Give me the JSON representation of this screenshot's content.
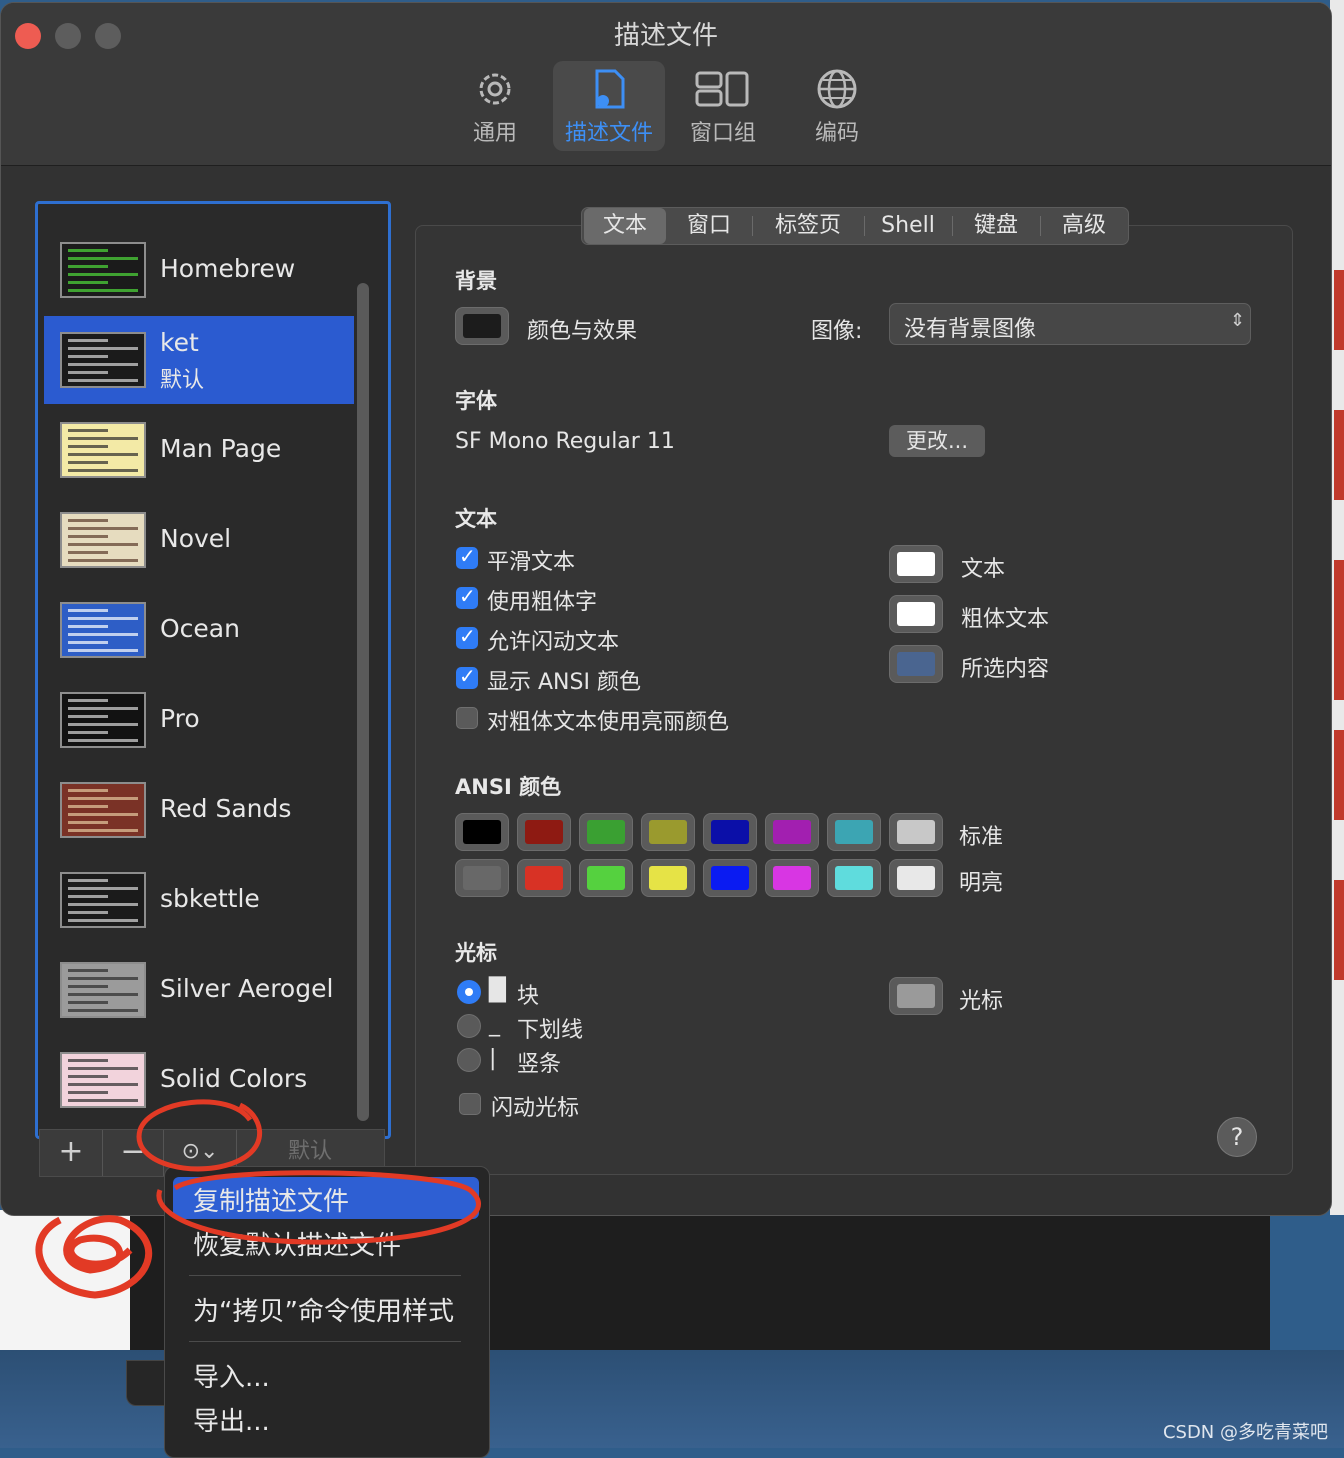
{
  "window": {
    "title": "描述文件"
  },
  "toolbar": {
    "items": [
      {
        "label": "通用",
        "icon": "gear-icon"
      },
      {
        "label": "描述文件",
        "icon": "profile-doc-icon"
      },
      {
        "label": "窗口组",
        "icon": "window-groups-icon"
      },
      {
        "label": "编码",
        "icon": "globe-icon"
      }
    ],
    "active": "描述文件"
  },
  "profiles": {
    "items": [
      {
        "name": "Homebrew",
        "thumb_bg": "#1b1b1b",
        "thumb_fg": "#4fdb3a"
      },
      {
        "name": "ket",
        "subtitle": "默认",
        "thumb_bg": "#1b1b1b",
        "thumb_fg": "#d8d8d8"
      },
      {
        "name": "Man Page",
        "thumb_bg": "#f3eaa6",
        "thumb_fg": "#2b2b2b"
      },
      {
        "name": "Novel",
        "thumb_bg": "#e6dcbf",
        "thumb_fg": "#5a3b2b"
      },
      {
        "name": "Ocean",
        "thumb_bg": "#2e5ec6",
        "thumb_fg": "#ffffff"
      },
      {
        "name": "Pro",
        "thumb_bg": "#121212",
        "thumb_fg": "#d8d8d8"
      },
      {
        "name": "Red Sands",
        "thumb_bg": "#7a3226",
        "thumb_fg": "#e6c9a0"
      },
      {
        "name": "sbkettle",
        "thumb_bg": "#1b1b1b",
        "thumb_fg": "#d8d8d8"
      },
      {
        "name": "Silver Aerogel",
        "thumb_bg": "#9b9b9b",
        "thumb_fg": "#2b2b2b"
      },
      {
        "name": "Solid Colors",
        "thumb_bg": "#f2d3dc",
        "thumb_fg": "#2b2b2b"
      }
    ],
    "selected": "ket",
    "buttons": {
      "add": "+",
      "remove": "−",
      "default": "默认"
    }
  },
  "tabs": {
    "items": [
      "文本",
      "窗口",
      "标签页",
      "Shell",
      "键盘",
      "高级"
    ],
    "active": "文本"
  },
  "background": {
    "heading": "背景",
    "color_label": "颜色与效果",
    "image_label": "图像:",
    "image_value": "没有背景图像"
  },
  "font": {
    "heading": "字体",
    "value": "SF Mono Regular 11",
    "change_button": "更改..."
  },
  "text": {
    "heading": "文本",
    "options": [
      {
        "label": "平滑文本",
        "checked": true
      },
      {
        "label": "使用粗体字",
        "checked": true
      },
      {
        "label": "允许闪动文本",
        "checked": true
      },
      {
        "label": "显示 ANSI 颜色",
        "checked": true
      },
      {
        "label": "对粗体文本使用亮丽颜色",
        "checked": false
      }
    ],
    "colors": [
      {
        "label": "文本",
        "color": "#ffffff"
      },
      {
        "label": "粗体文本",
        "color": "#ffffff"
      },
      {
        "label": "所选内容",
        "color": "#4a6590"
      }
    ]
  },
  "ansi": {
    "heading": "ANSI 颜色",
    "normal_label": "标准",
    "bright_label": "明亮",
    "normal": [
      "#000000",
      "#8e1a12",
      "#3aa032",
      "#9a9a2e",
      "#0b0fa8",
      "#a21fb0",
      "#3ca5b3",
      "#c8c8c8"
    ],
    "bright": [
      "#686868",
      "#d83225",
      "#55d13f",
      "#e6e346",
      "#0a1bf2",
      "#d836e3",
      "#5fdcdd",
      "#e8e8e8"
    ]
  },
  "cursor": {
    "heading": "光标",
    "options": [
      {
        "glyph": "█",
        "label": "块",
        "selected": true
      },
      {
        "glyph": "_",
        "label": "下划线",
        "selected": false
      },
      {
        "glyph": "|",
        "label": "竖条",
        "selected": false
      }
    ],
    "blink_label": "闪动光标",
    "blink_checked": false,
    "color_label": "光标",
    "color": "#9a9a9a"
  },
  "help": {
    "label": "?"
  },
  "menu": {
    "items": [
      "复制描述文件",
      "恢复默认描述文件",
      "为“拷贝”命令使用样式",
      "导入...",
      "导出..."
    ],
    "highlighted": "复制描述文件"
  },
  "watermark": "CSDN @多吃青菜吧",
  "colors": {
    "accent": "#2f7cf6",
    "selection": "#2b5bd0",
    "annotation": "#e23a25"
  }
}
